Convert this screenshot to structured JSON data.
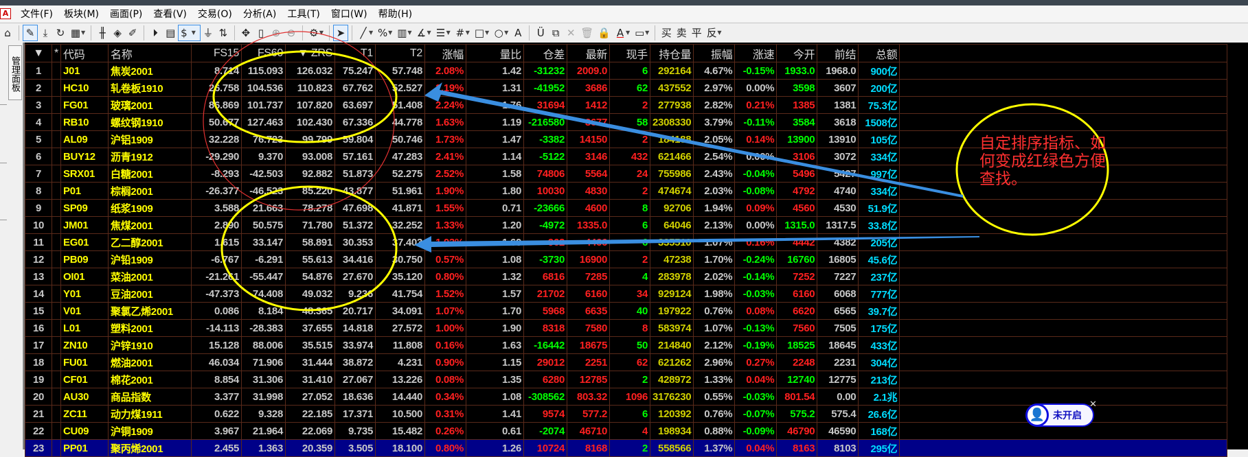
{
  "menu": {
    "logo": "A",
    "items": [
      "文件(F)",
      "板块(M)",
      "画面(P)",
      "查看(V)",
      "交易(O)",
      "分析(A)",
      "工具(T)",
      "窗口(W)",
      "帮助(H)"
    ]
  },
  "toolbar": {
    "currency": "$",
    "font_a": "A",
    "font_a2": "A",
    "buy": "买",
    "sell": "卖",
    "flat": "平",
    "reverse": "反",
    "percent": "%"
  },
  "sidebar": {
    "tab": "管理面板"
  },
  "table": {
    "headers": [
      "▼",
      "*",
      "代码",
      "名称",
      "FS15",
      "FS60",
      "▼ ZRS",
      "T1",
      "T2",
      "涨幅",
      "量比",
      "仓差",
      "最新",
      "现手",
      "持仓量",
      "振幅",
      "涨速",
      "今开",
      "前结",
      "总额"
    ],
    "selected_row": 23,
    "rows": [
      [
        "1",
        "J01",
        "焦炭2001",
        "8.714",
        "115.093",
        "126.032",
        "75.247",
        "57.748",
        "2.08%",
        "1.42",
        "-31232",
        "2009.0",
        "6",
        "292164",
        "4.67%",
        "-0.15%",
        "1933.0",
        "1968.0",
        "900亿",
        "g"
      ],
      [
        "2",
        "HC10",
        "轧卷板1910",
        "26.758",
        "104.536",
        "110.823",
        "67.762",
        "52.527",
        "2.19%",
        "1.31",
        "-41952",
        "3686",
        "62",
        "437552",
        "2.97%",
        "0.00%",
        "3598",
        "3607",
        "200亿",
        "g"
      ],
      [
        "3",
        "FG01",
        "玻璃2001",
        "86.869",
        "101.737",
        "107.820",
        "63.697",
        "51.408",
        "2.24%",
        "1.76",
        "31694",
        "1412",
        "2",
        "277938",
        "2.82%",
        "0.21%",
        "1385",
        "1381",
        "75.3亿",
        "r"
      ],
      [
        "4",
        "RB10",
        "螺纹钢1910",
        "50.677",
        "127.463",
        "102.430",
        "67.336",
        "44.778",
        "1.63%",
        "1.19",
        "-216580",
        "3677",
        "58",
        "2308330",
        "3.79%",
        "-0.11%",
        "3584",
        "3618",
        "1508亿",
        "g"
      ],
      [
        "5",
        "AL09",
        "沪铝1909",
        "32.228",
        "76.723",
        "99.799",
        "59.804",
        "50.746",
        "1.73%",
        "1.47",
        "-3382",
        "14150",
        "2",
        "184188",
        "2.05%",
        "0.14%",
        "13900",
        "13910",
        "105亿",
        "r"
      ],
      [
        "6",
        "BUY12",
        "沥青1912",
        "-29.290",
        "9.370",
        "93.008",
        "57.161",
        "47.283",
        "2.41%",
        "1.14",
        "-5122",
        "3146",
        "432",
        "621466",
        "2.54%",
        "0.00%",
        "3106",
        "3072",
        "334亿",
        "r"
      ],
      [
        "7",
        "SRX01",
        "白糖2001",
        "-8.293",
        "-42.503",
        "92.882",
        "51.873",
        "52.275",
        "2.52%",
        "1.58",
        "74806",
        "5564",
        "24",
        "755986",
        "2.43%",
        "-0.04%",
        "5496",
        "5427",
        "997亿",
        "r"
      ],
      [
        "8",
        "P01",
        "棕榈2001",
        "-26.377",
        "-46.523",
        "85.220",
        "43.877",
        "51.961",
        "1.90%",
        "1.80",
        "10030",
        "4830",
        "2",
        "474674",
        "2.03%",
        "-0.08%",
        "4792",
        "4740",
        "334亿",
        "r"
      ],
      [
        "9",
        "SP09",
        "纸浆1909",
        "3.588",
        "21.663",
        "78.278",
        "47.698",
        "41.871",
        "1.55%",
        "0.71",
        "-23666",
        "4600",
        "8",
        "92706",
        "1.94%",
        "0.09%",
        "4560",
        "4530",
        "51.9亿",
        "g"
      ],
      [
        "10",
        "JM01",
        "焦煤2001",
        "2.890",
        "50.575",
        "71.780",
        "51.372",
        "32.252",
        "1.33%",
        "1.20",
        "-4972",
        "1335.0",
        "6",
        "64046",
        "2.13%",
        "0.00%",
        "1315.0",
        "1317.5",
        "33.8亿",
        "g"
      ],
      [
        "11",
        "EG01",
        "乙二醇2001",
        "1.615",
        "33.147",
        "58.891",
        "30.353",
        "37.403",
        "1.03%",
        "1.60",
        "962",
        "4466",
        "6",
        "335510",
        "1.07%",
        "0.16%",
        "4442",
        "4382",
        "205亿",
        "g"
      ],
      [
        "12",
        "PB09",
        "沪铅1909",
        "-6.767",
        "-6.291",
        "55.613",
        "34.416",
        "30.750",
        "0.57%",
        "1.08",
        "-3730",
        "16900",
        "2",
        "47238",
        "1.70%",
        "-0.24%",
        "16760",
        "16805",
        "45.6亿",
        "r"
      ],
      [
        "13",
        "OI01",
        "菜油2001",
        "-21.261",
        "-55.447",
        "54.876",
        "27.670",
        "35.120",
        "0.80%",
        "1.32",
        "6816",
        "7285",
        "4",
        "283978",
        "2.02%",
        "-0.14%",
        "7252",
        "7227",
        "237亿",
        "g"
      ],
      [
        "14",
        "Y01",
        "豆油2001",
        "-47.373",
        "-74.408",
        "49.032",
        "9.236",
        "41.754",
        "1.52%",
        "1.57",
        "21702",
        "6160",
        "34",
        "929124",
        "1.98%",
        "-0.03%",
        "6160",
        "6068",
        "777亿",
        "r"
      ],
      [
        "15",
        "V01",
        "聚氯乙烯2001",
        "0.086",
        "8.184",
        "48.365",
        "20.717",
        "34.091",
        "1.07%",
        "1.70",
        "5968",
        "6635",
        "40",
        "197922",
        "0.76%",
        "0.08%",
        "6620",
        "6565",
        "39.7亿",
        "g"
      ],
      [
        "16",
        "L01",
        "塑料2001",
        "-14.113",
        "-28.383",
        "37.655",
        "14.818",
        "27.572",
        "1.00%",
        "1.90",
        "8318",
        "7580",
        "8",
        "583974",
        "1.07%",
        "-0.13%",
        "7560",
        "7505",
        "175亿",
        "r"
      ],
      [
        "17",
        "ZN10",
        "沪锌1910",
        "15.128",
        "88.006",
        "35.515",
        "33.974",
        "11.808",
        "0.16%",
        "1.63",
        "-16442",
        "18675",
        "50",
        "214840",
        "2.12%",
        "-0.19%",
        "18525",
        "18645",
        "433亿",
        "g"
      ],
      [
        "18",
        "FU01",
        "燃油2001",
        "46.034",
        "71.906",
        "31.444",
        "38.872",
        "4.231",
        "0.90%",
        "1.15",
        "29012",
        "2251",
        "62",
        "621262",
        "2.96%",
        "0.27%",
        "2248",
        "2231",
        "304亿",
        "r"
      ],
      [
        "19",
        "CF01",
        "棉花2001",
        "8.854",
        "31.306",
        "31.410",
        "27.067",
        "13.226",
        "0.08%",
        "1.35",
        "6280",
        "12785",
        "2",
        "428972",
        "1.33%",
        "0.04%",
        "12740",
        "12775",
        "213亿",
        "g"
      ],
      [
        "20",
        "AU30",
        "商品指数",
        "3.377",
        "31.998",
        "27.052",
        "18.636",
        "14.440",
        "0.34%",
        "1.08",
        "-308562",
        "803.32",
        "1096",
        "3176230",
        "0.55%",
        "-0.03%",
        "801.54",
        "0.00",
        "2.1兆",
        "r"
      ],
      [
        "21",
        "ZC11",
        "动力煤1911",
        "0.622",
        "9.328",
        "22.185",
        "17.371",
        "10.500",
        "0.31%",
        "1.41",
        "9574",
        "577.2",
        "6",
        "120392",
        "0.76%",
        "-0.07%",
        "575.2",
        "575.4",
        "26.6亿",
        "g"
      ],
      [
        "22",
        "CU09",
        "沪铜1909",
        "3.967",
        "21.964",
        "22.069",
        "9.735",
        "15.482",
        "0.26%",
        "0.61",
        "-2074",
        "46710",
        "4",
        "198934",
        "0.88%",
        "-0.09%",
        "46790",
        "46590",
        "168亿",
        "r"
      ],
      [
        "23",
        "PP01",
        "聚丙烯2001",
        "2.455",
        "1.363",
        "20.359",
        "3.505",
        "18.100",
        "0.80%",
        "1.26",
        "10724",
        "8168",
        "2",
        "558566",
        "1.37%",
        "0.04%",
        "8163",
        "8103",
        "295亿",
        "g"
      ]
    ]
  },
  "annotation": {
    "note": "自定排序指标、如何变成红绿色方便查找。",
    "annotation_color": "#ff3030",
    "circle_color": "#ffff00",
    "arrow_color": "#3a8ee0"
  },
  "badge": {
    "label": "未开启",
    "close": "✕"
  }
}
